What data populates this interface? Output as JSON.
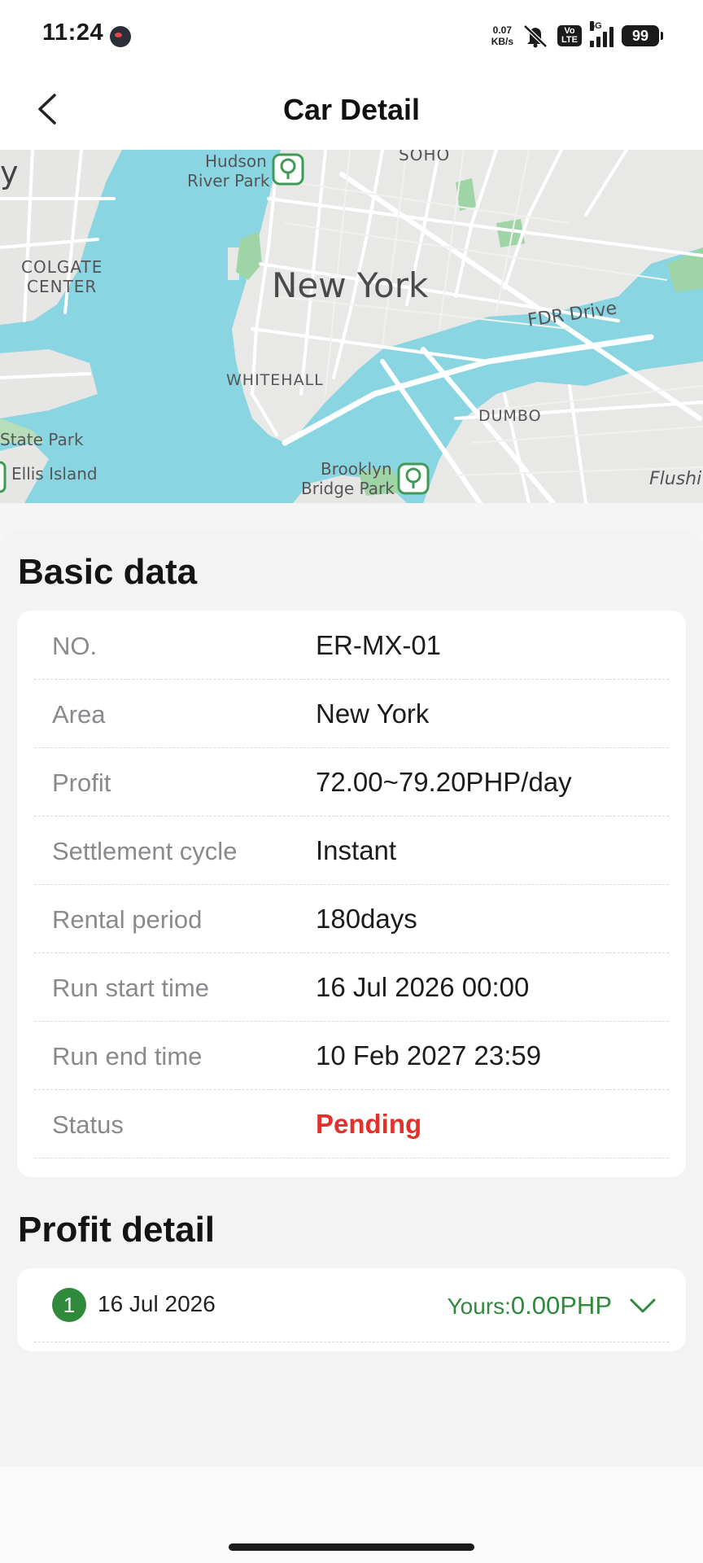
{
  "status_bar": {
    "time": "11:24",
    "net_speed_value": "0.07",
    "net_speed_unit": "KB/s",
    "volte_line1": "Vo",
    "volte_line2": "LTE",
    "network": "5G",
    "battery": "99"
  },
  "header": {
    "title": "Car Detail"
  },
  "map": {
    "labels": {
      "soho": "SOHO",
      "hudson_river_park_1": "Hudson",
      "hudson_river_park_2": "River Park",
      "colgate_center_1": "COLGATE",
      "colgate_center_2": "CENTER",
      "new_york": "New York",
      "fdr_drive": "FDR Drive",
      "whitehall": "WHITEHALL",
      "dumbo": "DUMBO",
      "state_park": "State Park",
      "ellis_island": "Ellis Island",
      "brooklyn_bridge_park_1": "Brooklyn",
      "brooklyn_bridge_park_2": "Bridge Park",
      "flushing": "Flushi",
      "left_edge": "y"
    },
    "colors": {
      "water": "#89d6e2",
      "land": "#e8e8e6",
      "park": "#9fd5a6",
      "road": "#ffffff"
    }
  },
  "basic_data": {
    "title": "Basic data",
    "rows": [
      {
        "label": "NO.",
        "value": "ER-MX-01"
      },
      {
        "label": "Area",
        "value": "New York"
      },
      {
        "label": "Profit",
        "value": "72.00~79.20PHP/day"
      },
      {
        "label": "Settlement cycle",
        "value": "Instant"
      },
      {
        "label": "Rental period",
        "value": "180days"
      },
      {
        "label": "Run start time",
        "value": "16 Jul 2026 00:00"
      },
      {
        "label": "Run end time",
        "value": "10 Feb 2027 23:59"
      },
      {
        "label": "Status",
        "value": "Pending"
      }
    ]
  },
  "profit_detail": {
    "title": "Profit detail",
    "items": [
      {
        "index": "1",
        "date": "16 Jul 2026",
        "yours_label": "Yours:",
        "amount": "0.00PHP"
      }
    ]
  },
  "colors": {
    "accent_green": "#2f8a3c",
    "status_red": "#e0312a"
  }
}
